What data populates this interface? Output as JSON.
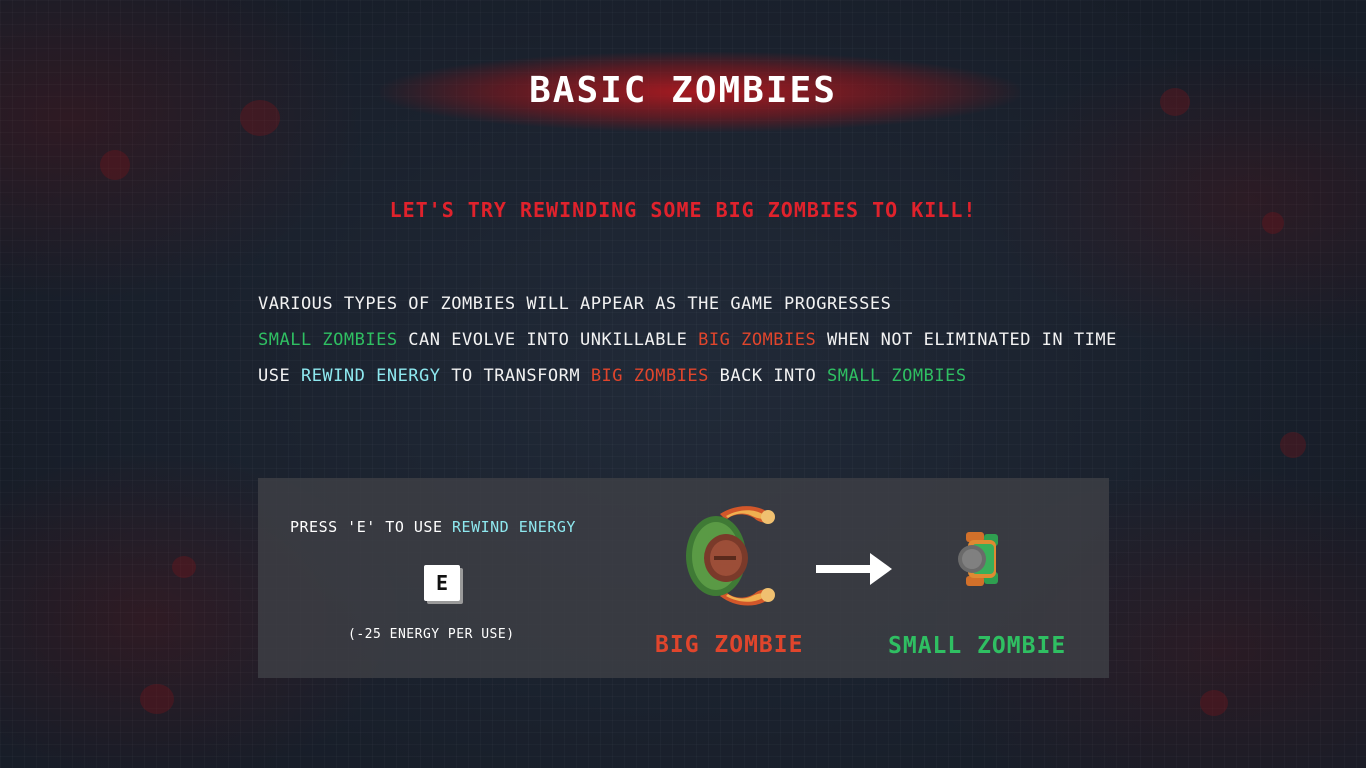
{
  "screen": {
    "title": "BASIC ZOMBIES",
    "subtitle": "LET'S TRY REWINDING SOME BIG ZOMBIES TO KILL!"
  },
  "description": {
    "line1": "VARIOUS TYPES OF ZOMBIES WILL APPEAR AS THE GAME PROGRESSES",
    "line2": {
      "small_zombies": "SMALL ZOMBIES",
      "part1": " CAN EVOLVE INTO UNKILLABLE ",
      "big_zombies": "BIG ZOMBIES",
      "part2": " WHEN NOT ELIMINATED IN TIME"
    },
    "line3": {
      "use": "USE ",
      "rewind_energy": "REWIND ENERGY",
      "part1": " TO TRANSFORM ",
      "big_zombies": "BIG ZOMBIES",
      "part2": " BACK INTO ",
      "small_zombies": "SMALL ZOMBIES"
    }
  },
  "panel": {
    "press_prefix": "PRESS 'E' TO USE ",
    "press_highlight": "REWIND ENERGY",
    "key": "E",
    "cost": "(-25 ENERGY PER USE)",
    "big_zombie_label": "BIG ZOMBIE",
    "small_zombie_label": "SMALL ZOMBIE",
    "big_zombie_icon": "big-zombie-sprite",
    "small_zombie_icon": "small-zombie-sprite",
    "arrow_icon": "right-arrow"
  },
  "colors": {
    "title_glow": "#be191e",
    "subtitle": "#e0222c",
    "small_zombies": "#2fbf62",
    "big_zombies": "#e0452c",
    "rewind_energy": "#8ee8ef"
  }
}
